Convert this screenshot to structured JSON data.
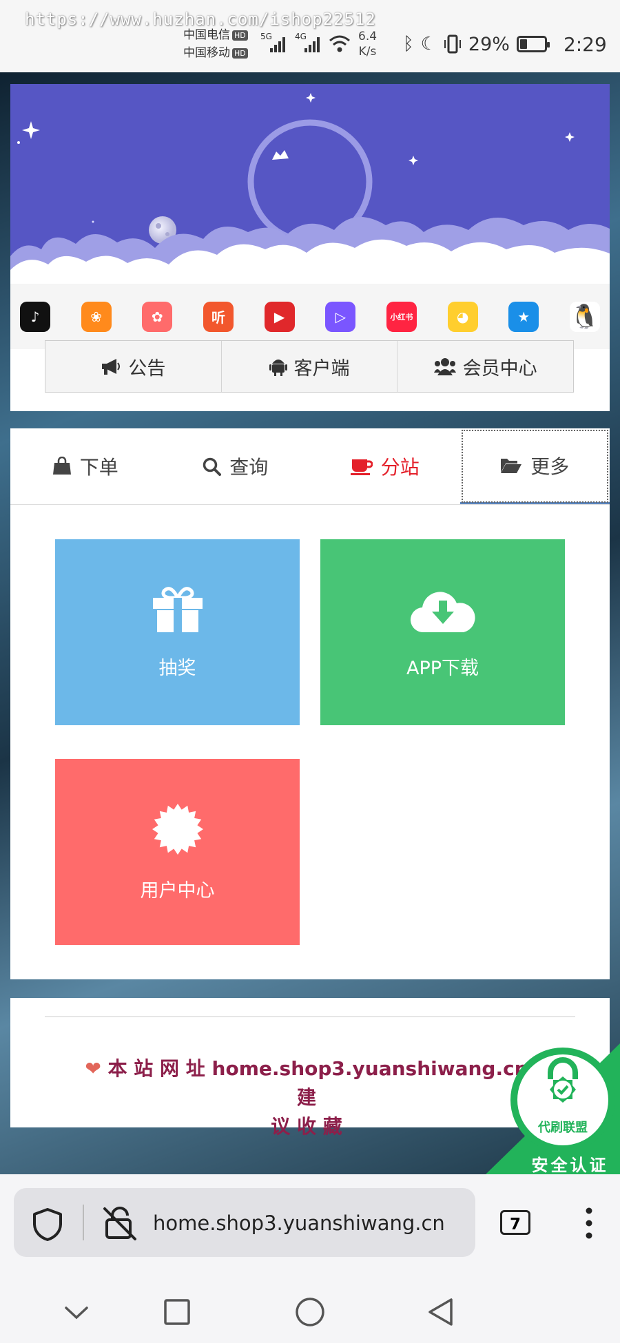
{
  "status_bar": {
    "watermark": "https://www.huzhan.com/ishop22512",
    "carrier1": "中国电信",
    "carrier2": "中国移动",
    "hd": "HD",
    "net1": "5G",
    "net2": "4G",
    "speed_value": "6.4",
    "speed_unit": "K/s",
    "battery_text": "29%",
    "battery_level": 0.29,
    "time": "2:29"
  },
  "header": {
    "app_icons": [
      {
        "name": "douyin",
        "color": "#111111",
        "glyph": "♪"
      },
      {
        "name": "kuaishou",
        "color": "#ff8a1c",
        "glyph": "❀"
      },
      {
        "name": "pipixia",
        "color": "#ff6b6b",
        "glyph": "✿"
      },
      {
        "name": "ting",
        "color": "#f2572d",
        "glyph": "听"
      },
      {
        "name": "video",
        "color": "#e0282b",
        "glyph": "▶"
      },
      {
        "name": "weishi",
        "color": "#7a56ff",
        "glyph": "▷"
      },
      {
        "name": "xiaohongshu",
        "color": "#ff2442",
        "glyph": "小红书"
      },
      {
        "name": "game",
        "color": "#ffce2e",
        "glyph": "◕"
      },
      {
        "name": "qzone",
        "color": "#1a8fe8",
        "glyph": "★"
      },
      {
        "name": "qq",
        "color": "#ffffff",
        "glyph": "🐧"
      }
    ],
    "buttons": [
      {
        "icon": "megaphone-icon",
        "label": "公告"
      },
      {
        "icon": "android-icon",
        "label": "客户端"
      },
      {
        "icon": "users-icon",
        "label": "会员中心"
      }
    ]
  },
  "tabs": [
    {
      "icon": "shopping-bag-icon",
      "label": "下单"
    },
    {
      "icon": "search-icon",
      "label": "查询"
    },
    {
      "icon": "coffee-icon",
      "label": "分站"
    },
    {
      "icon": "folder-open-icon",
      "label": "更多"
    }
  ],
  "tiles": [
    {
      "icon": "gift-icon",
      "label": "抽奖",
      "color": "#6cb8e9"
    },
    {
      "icon": "cloud-download-icon",
      "label": "APP下载",
      "color": "#48c576"
    },
    {
      "icon": "certificate-icon",
      "label": "用户中心",
      "color": "#ff6b6b"
    }
  ],
  "footer": {
    "heart": "❤",
    "notice_line1": "本 站 网 址 home.shop3.yuanshiwang.cn 建",
    "notice_line2": "议 收 藏",
    "badge_name": "代刷联盟",
    "badge_text": "安全认证"
  },
  "browser": {
    "url": "home.shop3.yuanshiwang.cn",
    "tab_count": "7"
  }
}
